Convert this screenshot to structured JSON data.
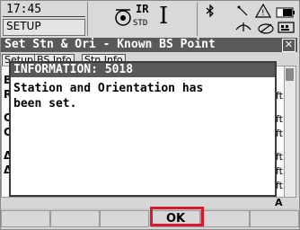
{
  "status": {
    "time": "17:45",
    "mode": "SETUP",
    "ir_label": "IR",
    "std_label": "STD",
    "cursor_glyph": "I",
    "icons": [
      "prism-icon",
      "cursor-icon",
      "bluetooth-icon",
      "antenna-icon",
      "battery-icon",
      "signal-icon"
    ]
  },
  "title": "Set Stn & Ori - Known BS Point",
  "tabs": [
    "Setup",
    "BS Info",
    "Stn Info"
  ],
  "form": {
    "rows": [
      "Back",
      "Ref",
      "Calc",
      "Calc",
      "ΔHo",
      "ΔHe"
    ],
    "units": [
      "ft",
      "ft",
      "ft",
      "ft",
      "ft",
      "ft"
    ],
    "hint": "A"
  },
  "dialog": {
    "title": "INFORMATION: 5018",
    "message": "Station and Orientation has\nbeen set."
  },
  "softkeys": [
    "",
    "",
    "",
    "OK",
    "",
    ""
  ],
  "accent": "#d81b2c"
}
